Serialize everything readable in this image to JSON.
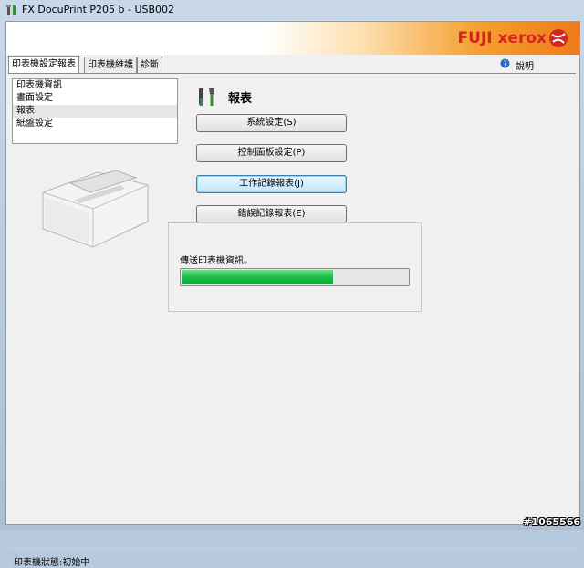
{
  "window": {
    "title": "FX DocuPrint P205 b - USB002"
  },
  "banner": {
    "logo_text": "FUJI xerox"
  },
  "tabs": [
    {
      "label": "印表機設定報表"
    },
    {
      "label": "印表機維護"
    },
    {
      "label": "診斷"
    }
  ],
  "help": {
    "label": "說明"
  },
  "sidebar": {
    "items": [
      {
        "label": "印表機資訊"
      },
      {
        "label": "畫面設定"
      },
      {
        "label": "報表"
      },
      {
        "label": "紙盤設定"
      }
    ],
    "selected": "報表"
  },
  "section": {
    "title": "報表",
    "buttons": [
      {
        "label": "系統設定(S)"
      },
      {
        "label": "控制面板設定(P)"
      },
      {
        "label": "工作記錄報表(J)"
      },
      {
        "label": "錯誤記錄報表(E)"
      }
    ]
  },
  "progress": {
    "message": "傳送印表機資訊。",
    "fraction": 0.67
  },
  "status": {
    "text": "印表機狀態:初始中"
  },
  "watermark": {
    "text": "#1065566"
  },
  "colors": {
    "brand_red": "#d7261e",
    "progress_green": "#1fc04a",
    "banner_orange": "#ef7a1a"
  }
}
